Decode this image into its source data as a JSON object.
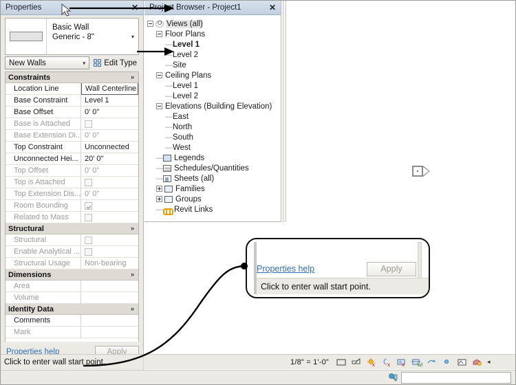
{
  "properties_palette": {
    "title": "Properties",
    "close_label": "✕",
    "type_selector": {
      "family": "Basic Wall",
      "type": "Generic - 8\"",
      "caret": "▾"
    },
    "instance_combo": {
      "value": "New Walls",
      "caret": "▾"
    },
    "edit_type_label": "Edit Type",
    "groups": [
      {
        "name": "Constraints",
        "rows": [
          {
            "name": "Location Line",
            "value": "Wall Centerline",
            "kind": "text",
            "disabled": false,
            "selected": true
          },
          {
            "name": "Base Constraint",
            "value": "Level 1",
            "kind": "text",
            "disabled": false,
            "selected": false
          },
          {
            "name": "Base Offset",
            "value": "0'  0\"",
            "kind": "text",
            "disabled": false,
            "selected": false
          },
          {
            "name": "Base is Attached",
            "value": "",
            "kind": "checkbox",
            "checked": false,
            "disabled": true,
            "selected": false
          },
          {
            "name": "Base Extension Di...",
            "value": "0'  0\"",
            "kind": "text",
            "disabled": true,
            "selected": false
          },
          {
            "name": "Top Constraint",
            "value": "Unconnected",
            "kind": "text",
            "disabled": false,
            "selected": false
          },
          {
            "name": "Unconnected Hei...",
            "value": "20'  0\"",
            "kind": "text",
            "disabled": false,
            "selected": false
          },
          {
            "name": "Top Offset",
            "value": "0'  0\"",
            "kind": "text",
            "disabled": true,
            "selected": false
          },
          {
            "name": "Top is Attached",
            "value": "",
            "kind": "checkbox",
            "checked": false,
            "disabled": true,
            "selected": false
          },
          {
            "name": "Top Extension Dis...",
            "value": "0'  0\"",
            "kind": "text",
            "disabled": true,
            "selected": false
          },
          {
            "name": "Room Bounding",
            "value": "",
            "kind": "checkbox",
            "checked": true,
            "disabled": true,
            "selected": false
          },
          {
            "name": "Related to Mass",
            "value": "",
            "kind": "checkbox",
            "checked": false,
            "disabled": true,
            "selected": false
          }
        ]
      },
      {
        "name": "Structural",
        "rows": [
          {
            "name": "Structural",
            "value": "",
            "kind": "checkbox",
            "checked": false,
            "disabled": true,
            "selected": false
          },
          {
            "name": "Enable Analytical ...",
            "value": "",
            "kind": "checkbox",
            "checked": false,
            "disabled": true,
            "selected": false
          },
          {
            "name": "Structural Usage",
            "value": "Non-bearing",
            "kind": "text",
            "disabled": true,
            "selected": false
          }
        ]
      },
      {
        "name": "Dimensions",
        "rows": [
          {
            "name": "Area",
            "value": "",
            "kind": "text",
            "disabled": true,
            "selected": false
          },
          {
            "name": "Volume",
            "value": "",
            "kind": "text",
            "disabled": true,
            "selected": false
          }
        ]
      },
      {
        "name": "Identity Data",
        "rows": [
          {
            "name": "Comments",
            "value": "",
            "kind": "text",
            "disabled": false,
            "selected": false
          },
          {
            "name": "Mark",
            "value": "",
            "kind": "text",
            "disabled": true,
            "selected": false
          }
        ]
      }
    ],
    "collapse_chevron": "»",
    "help_link": "Properties help",
    "apply_label": "Apply"
  },
  "project_browser": {
    "title": "Project Browser - Project1",
    "close_label": "✕",
    "tree": [
      {
        "label": "Views (all)",
        "level": 0,
        "toggle": "minus",
        "icon": "views-icon",
        "bold": false,
        "selected": true
      },
      {
        "label": "Floor Plans",
        "level": 1,
        "toggle": "minus",
        "icon": "",
        "bold": false,
        "selected": false
      },
      {
        "label": "Level 1",
        "level": 2,
        "toggle": "leaf",
        "icon": "",
        "bold": true,
        "selected": false
      },
      {
        "label": "Level 2",
        "level": 2,
        "toggle": "leaf",
        "icon": "",
        "bold": false,
        "selected": false
      },
      {
        "label": "Site",
        "level": 2,
        "toggle": "leaf",
        "icon": "",
        "bold": false,
        "selected": false
      },
      {
        "label": "Ceiling Plans",
        "level": 1,
        "toggle": "minus",
        "icon": "",
        "bold": false,
        "selected": false
      },
      {
        "label": "Level 1",
        "level": 2,
        "toggle": "leaf",
        "icon": "",
        "bold": false,
        "selected": false
      },
      {
        "label": "Level 2",
        "level": 2,
        "toggle": "leaf",
        "icon": "",
        "bold": false,
        "selected": false
      },
      {
        "label": "Elevations (Building Elevation)",
        "level": 1,
        "toggle": "minus",
        "icon": "",
        "bold": false,
        "selected": false
      },
      {
        "label": "East",
        "level": 2,
        "toggle": "leaf",
        "icon": "",
        "bold": false,
        "selected": false
      },
      {
        "label": "North",
        "level": 2,
        "toggle": "leaf",
        "icon": "",
        "bold": false,
        "selected": false
      },
      {
        "label": "South",
        "level": 2,
        "toggle": "leaf",
        "icon": "",
        "bold": false,
        "selected": false
      },
      {
        "label": "West",
        "level": 2,
        "toggle": "leaf",
        "icon": "",
        "bold": false,
        "selected": false
      },
      {
        "label": "Legends",
        "level": 1,
        "toggle": "leaf",
        "icon": "legend-icon",
        "bold": false,
        "selected": false
      },
      {
        "label": "Schedules/Quantities",
        "level": 1,
        "toggle": "leaf",
        "icon": "schedule-icon",
        "bold": false,
        "selected": false
      },
      {
        "label": "Sheets (all)",
        "level": 1,
        "toggle": "leaf",
        "icon": "sheet-icon",
        "bold": false,
        "selected": false
      },
      {
        "label": "Families",
        "level": 1,
        "toggle": "plus",
        "icon": "family-icon",
        "bold": false,
        "selected": false
      },
      {
        "label": "Groups",
        "level": 1,
        "toggle": "plus",
        "icon": "group-icon",
        "bold": false,
        "selected": false
      },
      {
        "label": "Revit Links",
        "level": 1,
        "toggle": "leaf",
        "icon": "revit-link-icon",
        "bold": false,
        "selected": false
      }
    ]
  },
  "canvas": {
    "elevation_marker_name": "elevation-marker"
  },
  "callout": {
    "help_link": "Properties help",
    "apply_label": "Apply",
    "status_text": "Click to enter wall start point."
  },
  "status_bar": {
    "message": "Click to enter wall start point."
  },
  "view_control_bar": {
    "scale": "1/8\" = 1'-0\"",
    "icons": [
      "detail-level-icon",
      "visual-style-icon",
      "sun-path-icon",
      "shadows-icon",
      "rendering-dialog-icon",
      "crop-view-icon",
      "show-crop-region-icon",
      "temporary-hide-isolate-icon",
      "reveal-hidden-elements-icon",
      "worksharing-display-icon",
      "temporary-view-properties-icon"
    ],
    "expand_arrow": "◂"
  },
  "bottom_bar": {
    "filter_icon": "filter-icon",
    "search_value": ""
  },
  "colors": {
    "panel_bg": "#eceae4",
    "title_bar": "#c9d7e6",
    "link": "#2f6fba",
    "accent_yellow": "#e0a000",
    "border": "#b8b6b0"
  }
}
